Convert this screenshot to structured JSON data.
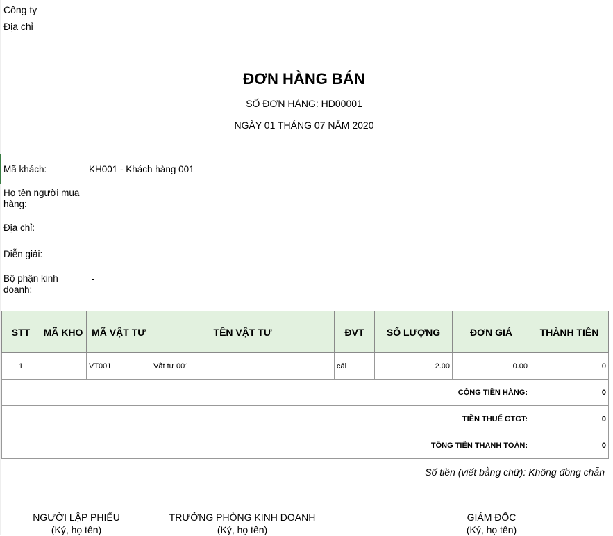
{
  "company": {
    "name_label": "Công ty",
    "address_label": "Địa chỉ"
  },
  "doc": {
    "title": "ĐƠN HÀNG BÁN",
    "order_no": "SỐ ĐƠN HÀNG: HD00001",
    "date": "NGÀY 01 THÁNG 07 NĂM 2020"
  },
  "info": {
    "customer_code_label": "Mã khách:",
    "customer_code_value": "KH001 - Khách hàng 001",
    "buyer_label": "Họ tên người mua hàng:",
    "address_label": "Địa chỉ:",
    "description_label": "Diễn giải:",
    "dept_label": "Bộ phận kinh doanh:",
    "dept_value": "-"
  },
  "table": {
    "headers": [
      "STT",
      "MÃ KHO",
      "MÃ VẬT TƯ",
      "TÊN VẬT TƯ",
      "ĐVT",
      "SỐ LƯỢNG",
      "ĐƠN GIÁ",
      "THÀNH TIỀN"
    ],
    "rows": [
      {
        "stt": "1",
        "warehouse": "",
        "code": "VT001",
        "name": "Vắt tư 001",
        "unit": "cái",
        "qty": "2.00",
        "price": "0.00",
        "amount": "0"
      }
    ],
    "totals": [
      {
        "label": "CỘNG TIỀN HÀNG:",
        "value": "0"
      },
      {
        "label": "TIỀN THUẾ GTGT:",
        "value": "0"
      },
      {
        "label": "TỔNG TIỀN THANH TOÁN:",
        "value": "0"
      }
    ]
  },
  "amount_in_words": "Số tiền (viết bằng chữ): Không đồng chẵn",
  "signatures": [
    {
      "title": "NGƯỜI LẬP PHIẾU",
      "note": "(Ký, họ tên)"
    },
    {
      "title": "TRƯỞNG PHÒNG KINH DOANH",
      "note": "(Ký, họ tên)"
    },
    {
      "title": "GIÁM ĐỐC",
      "note": "(Ký, họ tên)"
    }
  ]
}
